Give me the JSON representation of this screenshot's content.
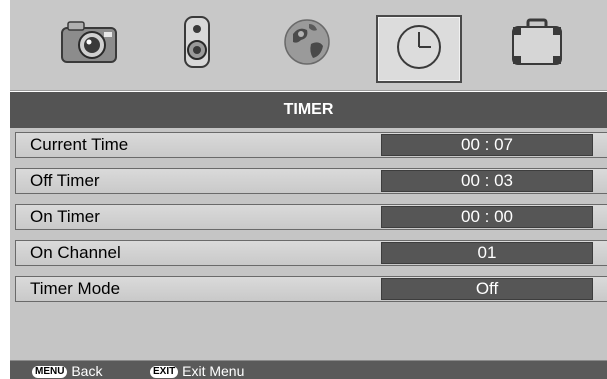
{
  "icon_tabs": [
    {
      "icon": "camera-icon",
      "active": false
    },
    {
      "icon": "speaker-icon",
      "active": false
    },
    {
      "icon": "globe-icon",
      "active": false
    },
    {
      "icon": "clock-icon",
      "active": true
    },
    {
      "icon": "briefcase-icon",
      "active": false
    }
  ],
  "panel": {
    "title": "TIMER",
    "rows": [
      {
        "label": "Current Time",
        "value": "00 : 07"
      },
      {
        "label": "Off Timer",
        "value": "00 : 03"
      },
      {
        "label": "On Timer",
        "value": "00 : 00"
      },
      {
        "label": "On Channel",
        "value": "01"
      },
      {
        "label": "Timer Mode",
        "value": "Off"
      }
    ]
  },
  "footer": {
    "back_key": "MENU",
    "back_label": "Back",
    "exit_key": "EXIT",
    "exit_label": "Exit Menu"
  },
  "colors": {
    "header_bar": "#545454",
    "value_box": "#565656",
    "panel_bg": "#c5c5c5"
  }
}
